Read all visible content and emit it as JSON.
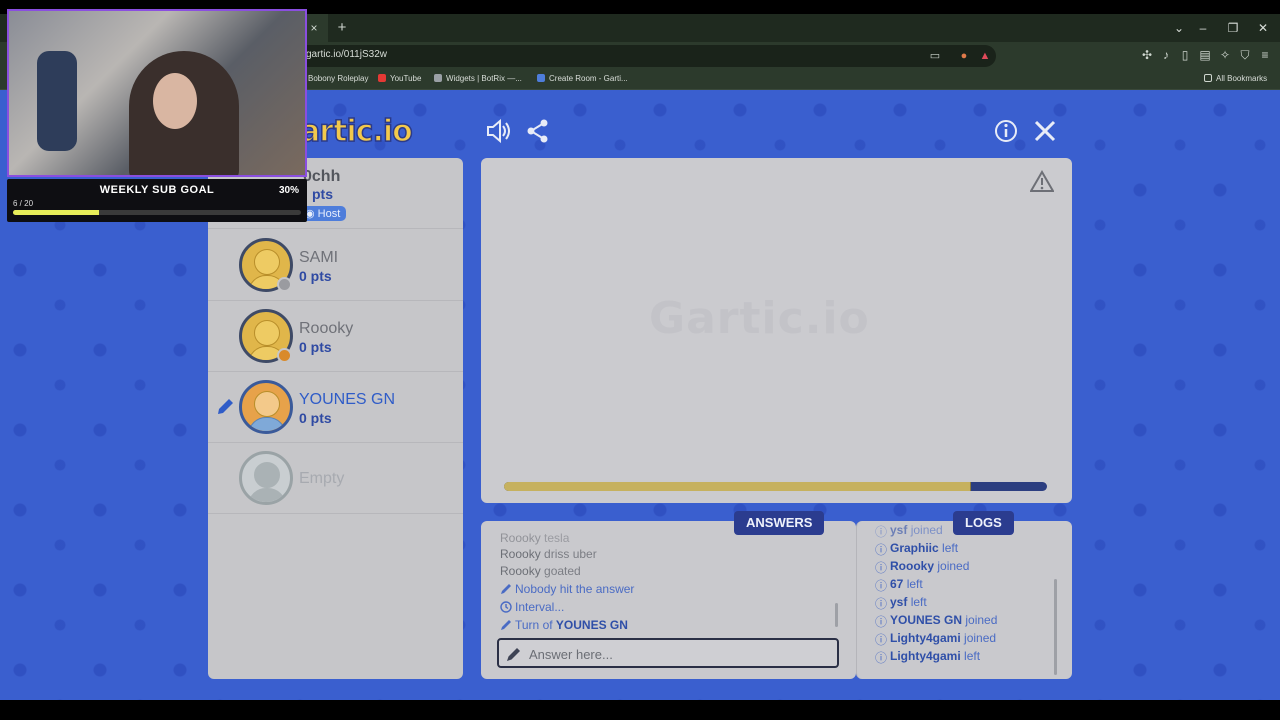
{
  "browser": {
    "tab_close": "×",
    "new_tab": "+",
    "url": "gartic.io/011jS32w",
    "bookmarks": [
      {
        "label": "Bobony Roleplay",
        "color": "#3a3a3a"
      },
      {
        "label": "YouTube",
        "color": "#e53935"
      },
      {
        "label": "Widgets | BotRix —...",
        "color": "#9aa0a6"
      },
      {
        "label": "Create Room - Garti...",
        "color": "#4e7ddb"
      }
    ],
    "all_bookmarks": "All Bookmarks"
  },
  "game": {
    "logo": "artic.io",
    "watermark": "Gartic.io",
    "timer_fraction": 0.86
  },
  "players": [
    {
      "name": "0chh",
      "points": "pts",
      "badge": "Host"
    },
    {
      "name": "SAMI",
      "points": "0 pts",
      "status_color": "#9a9ba0"
    },
    {
      "name": "Roooky",
      "points": "0 pts",
      "status_color": "#d98a2b"
    },
    {
      "name": "YOUNES GN",
      "points": "0 pts",
      "drawing": true
    },
    {
      "name": "Empty",
      "points": ""
    }
  ],
  "answers": {
    "tab_label": "ANSWERS",
    "placeholder": "Answer here...",
    "lines": [
      {
        "user": "Roooky",
        "text": "tesla"
      },
      {
        "user": "Roooky",
        "text": "driss uber"
      },
      {
        "user": "Roooky",
        "text": "goated"
      },
      {
        "user": "",
        "text": "Nobody hit the answer",
        "icon": "pencil-icon"
      },
      {
        "user": "",
        "text": "Interval...",
        "icon": "clock-icon"
      },
      {
        "user": "YOUNES GN",
        "prefix": "Turn of ",
        "icon": "pencil-icon"
      }
    ]
  },
  "logs": {
    "tab_label": "LOGS",
    "lines": [
      {
        "user": "ysf",
        "text": "joined"
      },
      {
        "user": "Graphiic",
        "text": "left"
      },
      {
        "user": "Roooky",
        "text": "joined"
      },
      {
        "user": "67",
        "text": "left"
      },
      {
        "user": "ysf",
        "text": "left"
      },
      {
        "user": "YOUNES GN",
        "text": "joined"
      },
      {
        "user": "Lighty4gami",
        "text": "joined"
      },
      {
        "user": "Lighty4gami",
        "text": "left"
      }
    ]
  },
  "stream_overlay": {
    "goal_title": "WEEKLY SUB GOAL",
    "goal_percent": "30%",
    "goal_count": "6 / 20",
    "goal_fraction": 0.3
  }
}
